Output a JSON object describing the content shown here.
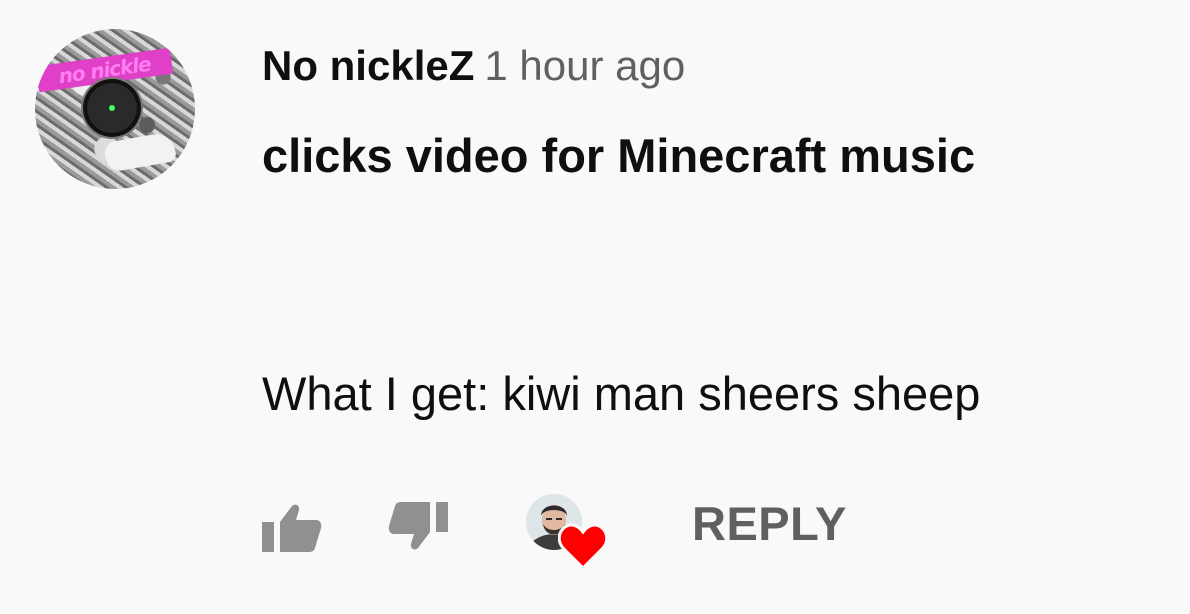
{
  "comment": {
    "author": "No nickleZ",
    "timestamp": "1 hour ago",
    "avatar_logo_text": "no nickle",
    "lines": [
      "clicks video for Minecraft music",
      "What I get: kiwi man sheers sheep"
    ]
  },
  "actions": {
    "like_icon": "thumb-up-icon",
    "dislike_icon": "thumb-down-icon",
    "creator_heart_icon": "heart-icon",
    "reply_label": "REPLY"
  },
  "colors": {
    "background": "#f9f9f9",
    "author_text": "#0f0f0f",
    "meta_text": "#606060",
    "icon": "#909090",
    "heart": "#ff0000"
  }
}
